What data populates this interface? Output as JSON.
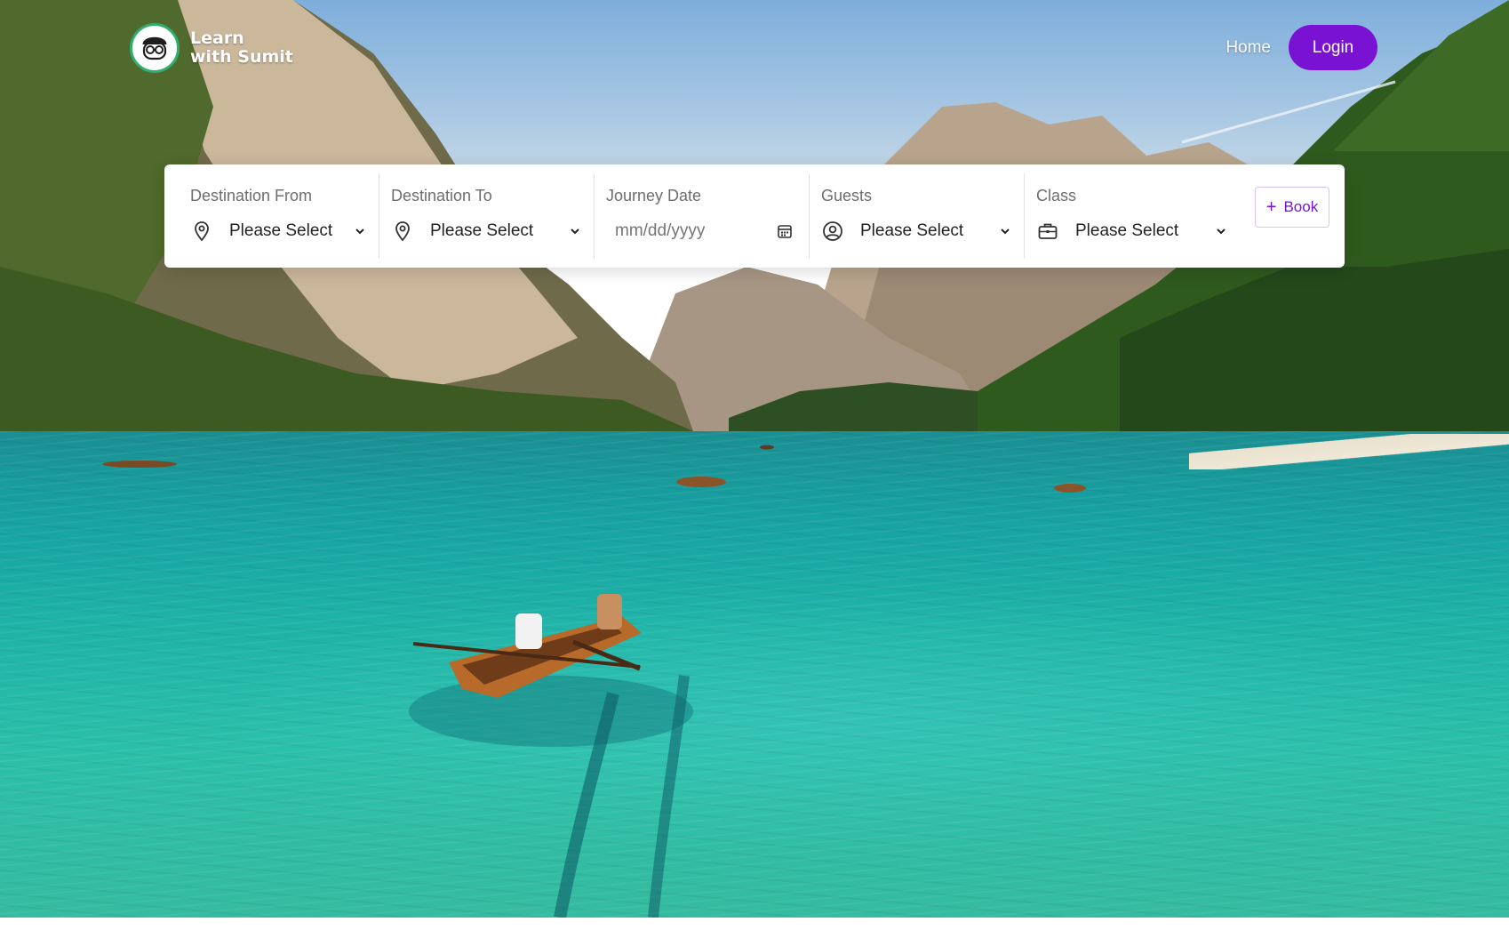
{
  "header": {
    "logo_line1": "Learn",
    "logo_line2": "with Sumit",
    "nav_home": "Home",
    "nav_login": "Login"
  },
  "booking": {
    "fields": [
      {
        "label": "Destination From",
        "value": "Please Select",
        "icon": "map-pin-icon"
      },
      {
        "label": "Destination To",
        "value": "Please Select",
        "icon": "map-pin-icon"
      },
      {
        "label": "Journey Date",
        "placeholder": "mm/dd/yyyy",
        "icon": "calendar-icon"
      },
      {
        "label": "Guests",
        "value": "Please Select",
        "icon": "user-circle-icon"
      },
      {
        "label": "Class",
        "value": "Please Select",
        "icon": "briefcase-icon"
      }
    ],
    "book_label": "Book",
    "book_icon": "plus-icon"
  },
  "colors": {
    "accent": "#7a12d4",
    "logo_ring": "#2fae6e",
    "water": "#1fb3a8"
  }
}
